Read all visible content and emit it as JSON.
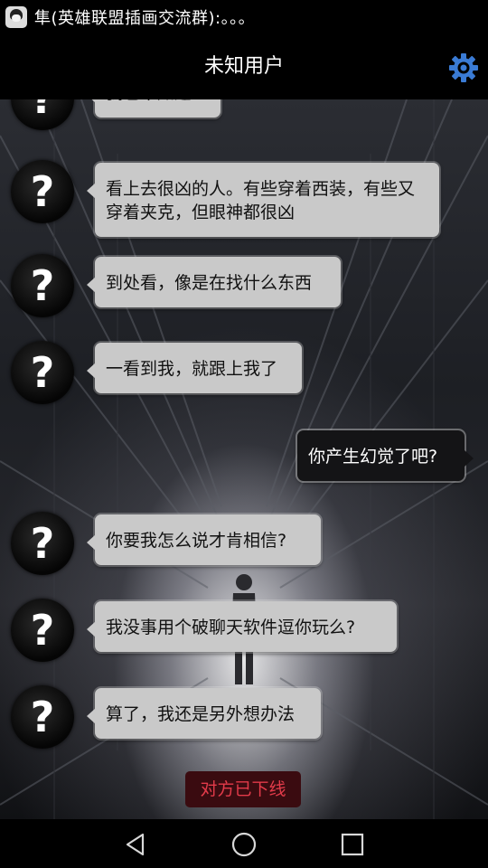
{
  "status_bar": {
    "notification_text": "隼(英雄联盟插画交流群):。。。"
  },
  "header": {
    "title": "未知用户",
    "settings_icon": "gear-icon",
    "accent_color": "#3a7bd5"
  },
  "messages": [
    {
      "side": "left",
      "avatar": "?",
      "text": "我也不知道..."
    },
    {
      "side": "left",
      "avatar": "?",
      "text": "看上去很凶的人。有些穿着西装，有些又穿着夹克，但眼神都很凶"
    },
    {
      "side": "left",
      "avatar": "?",
      "text": "到处看，像是在找什么东西"
    },
    {
      "side": "left",
      "avatar": "?",
      "text": "一看到我，就跟上我了"
    },
    {
      "side": "right",
      "text": "你产生幻觉了吧?"
    },
    {
      "side": "left",
      "avatar": "?",
      "text": "你要我怎么说才肯相信?"
    },
    {
      "side": "left",
      "avatar": "?",
      "text": "我没事用个破聊天软件逗你玩么?"
    },
    {
      "side": "left",
      "avatar": "?",
      "text": "算了，我还是另外想办法"
    }
  ],
  "system_notice": {
    "text": "对方已下线",
    "color": "#e33b4a"
  },
  "nav_bar": {
    "back_icon": "back-triangle-icon",
    "home_icon": "home-circle-icon",
    "recents_icon": "recents-square-icon"
  }
}
